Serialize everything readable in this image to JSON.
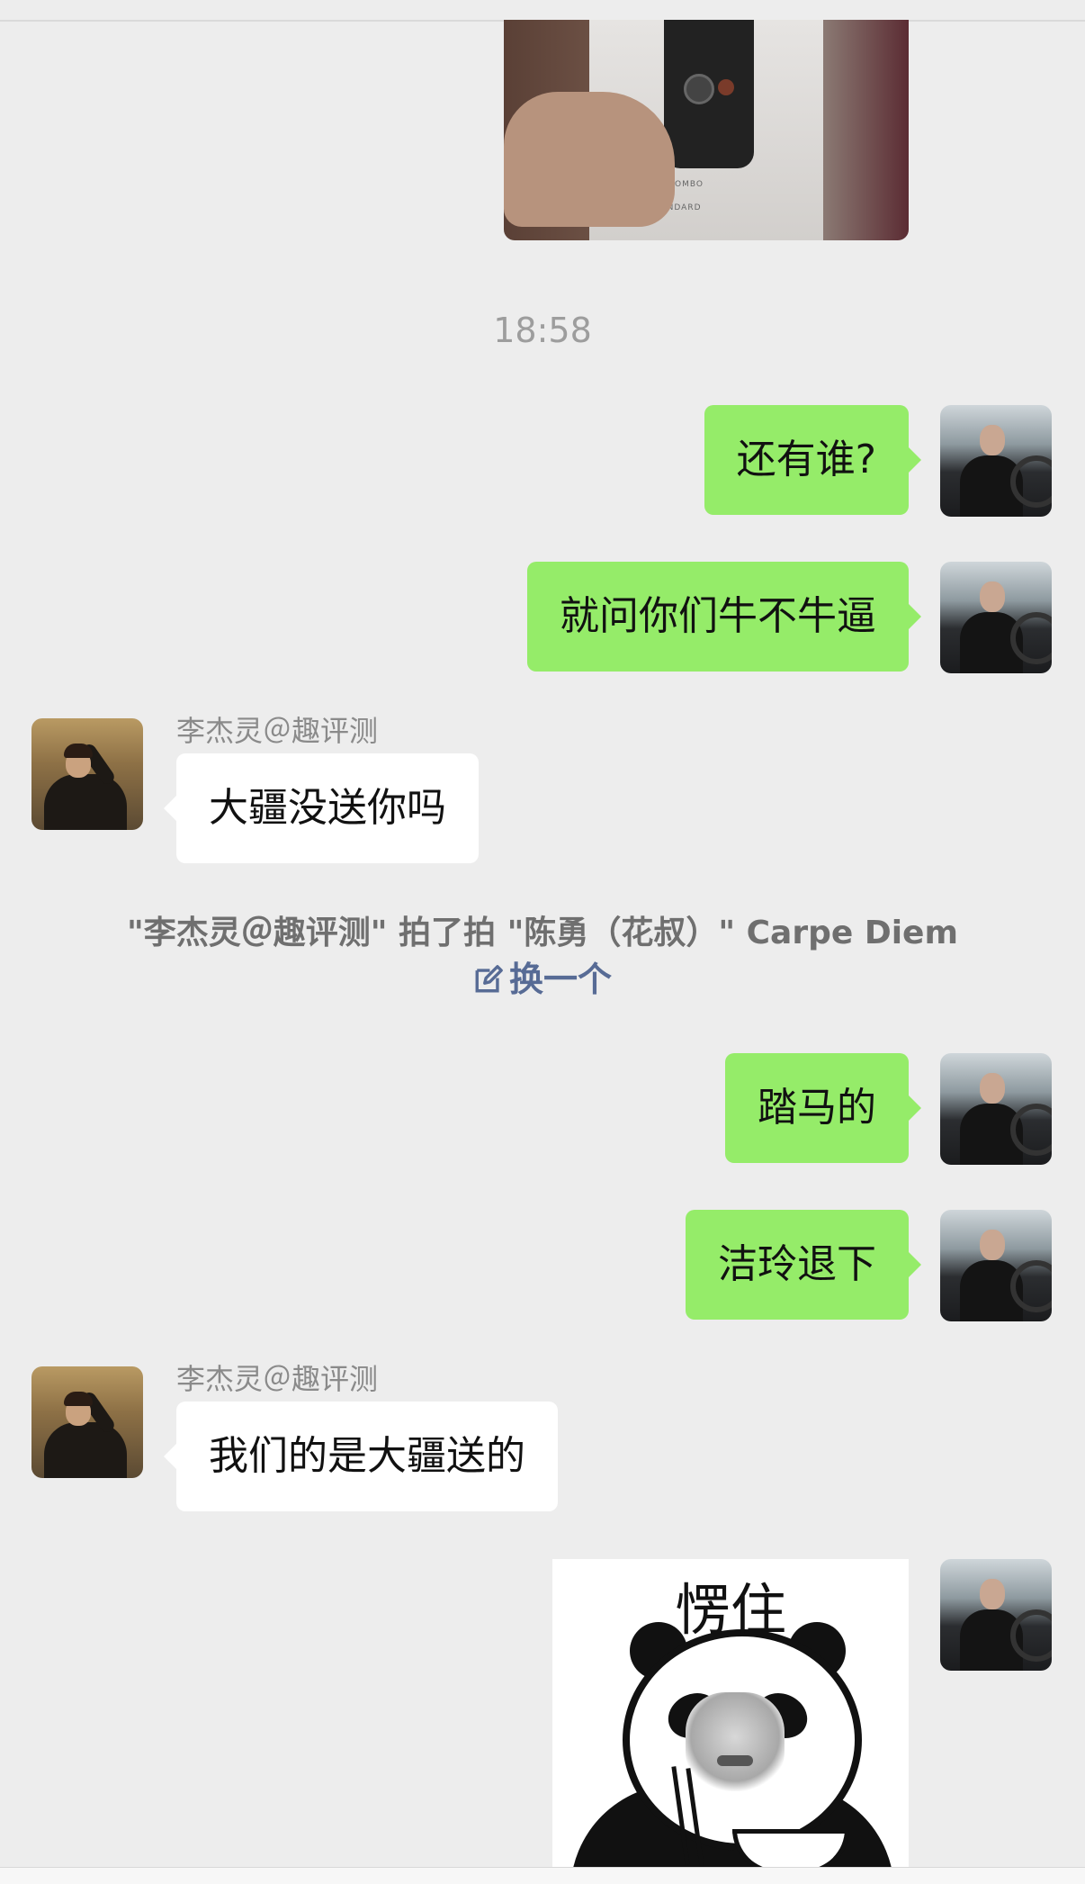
{
  "chat": {
    "timestamp": "18:58",
    "photo": {
      "text_line1": "OMBO",
      "text_line2": "STANDARD"
    },
    "messages": [
      {
        "from": "me",
        "text": "还有谁?"
      },
      {
        "from": "me",
        "text": "就问你们牛不牛逼"
      },
      {
        "from": "other",
        "sender": "李杰灵＠趣评测",
        "text": "大疆没送你吗"
      },
      {
        "from": "me",
        "text": "踏马的"
      },
      {
        "from": "me",
        "text": "洁玲退下"
      },
      {
        "from": "other",
        "sender": "李杰灵＠趣评测",
        "text": "我们的是大疆送的"
      }
    ],
    "pat_notice": {
      "text": "\"李杰灵＠趣评测\" 拍了拍 \"陈勇（花叔）\" Carpe Diem",
      "change_label": "换一个"
    },
    "sticker": {
      "caption": "愣住",
      "icon": "panda-meme-sticker"
    }
  },
  "colors": {
    "background": "#ededed",
    "bubble_me": "#95ec69",
    "bubble_other": "#ffffff",
    "link": "#576b95"
  }
}
